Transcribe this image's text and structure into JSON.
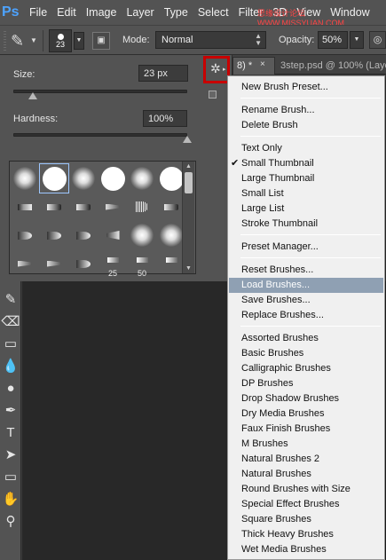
{
  "menubar": {
    "logo": "Ps",
    "items": [
      "File",
      "Edit",
      "Image",
      "Layer",
      "Type",
      "Select",
      "Filter",
      "3D",
      "View",
      "Window"
    ],
    "watermark": "思缘设计论坛 WWW.MISSYUAN.COM"
  },
  "options_bar": {
    "brush_size": "23",
    "mode_label": "Mode:",
    "mode_value": "Normal",
    "opacity_label": "Opacity:",
    "opacity_value": "50%"
  },
  "brush_panel": {
    "size_label": "Size:",
    "size_value": "23 px",
    "hardness_label": "Hardness:",
    "hardness_value": "100%",
    "size_slider_fraction": 0.11,
    "hardness_slider_fraction": 1.0,
    "presets": [
      {
        "tip": "soft",
        "num": ""
      },
      {
        "tip": "hard",
        "num": "",
        "selected": true
      },
      {
        "tip": "soft",
        "num": ""
      },
      {
        "tip": "hard",
        "num": ""
      },
      {
        "tip": "soft",
        "num": ""
      },
      {
        "tip": "hard",
        "num": ""
      },
      {
        "tip": "stroke",
        "num": ""
      },
      {
        "tip": "flat",
        "num": ""
      },
      {
        "tip": "flat",
        "num": ""
      },
      {
        "tip": "wedge",
        "num": ""
      },
      {
        "tip": "fan",
        "num": ""
      },
      {
        "tip": "flat",
        "num": ""
      },
      {
        "tip": "round",
        "num": ""
      },
      {
        "tip": "round",
        "num": ""
      },
      {
        "tip": "round",
        "num": ""
      },
      {
        "tip": "cone",
        "num": ""
      },
      {
        "tip": "soft",
        "num": ""
      },
      {
        "tip": "soft",
        "num": ""
      },
      {
        "tip": "wedge",
        "num": ""
      },
      {
        "tip": "wedge",
        "num": ""
      },
      {
        "tip": "round",
        "num": ""
      },
      {
        "tip": "small",
        "num": "25"
      },
      {
        "tip": "small",
        "num": "50"
      },
      {
        "tip": "small",
        "num": ""
      }
    ]
  },
  "tabs": [
    {
      "label": "8) *",
      "close": "×"
    },
    {
      "label": "3step.psd @ 100% (Layer"
    }
  ],
  "flyout_menu": {
    "groups": [
      {
        "items": [
          {
            "label": "New Brush Preset..."
          }
        ]
      },
      {
        "items": [
          {
            "label": "Rename Brush..."
          },
          {
            "label": "Delete Brush"
          }
        ]
      },
      {
        "items": [
          {
            "label": "Text Only"
          },
          {
            "label": "Small Thumbnail",
            "checked": true
          },
          {
            "label": "Large Thumbnail"
          },
          {
            "label": "Small List"
          },
          {
            "label": "Large List"
          },
          {
            "label": "Stroke Thumbnail"
          }
        ]
      },
      {
        "items": [
          {
            "label": "Preset Manager..."
          }
        ]
      },
      {
        "items": [
          {
            "label": "Reset Brushes..."
          },
          {
            "label": "Load Brushes...",
            "highlighted": true
          },
          {
            "label": "Save Brushes..."
          },
          {
            "label": "Replace Brushes..."
          }
        ]
      },
      {
        "items": [
          {
            "label": "Assorted Brushes"
          },
          {
            "label": "Basic Brushes"
          },
          {
            "label": "Calligraphic Brushes"
          },
          {
            "label": "DP Brushes"
          },
          {
            "label": "Drop Shadow Brushes"
          },
          {
            "label": "Dry Media Brushes"
          },
          {
            "label": "Faux Finish Brushes"
          },
          {
            "label": "M Brushes"
          },
          {
            "label": "Natural Brushes 2"
          },
          {
            "label": "Natural Brushes"
          },
          {
            "label": "Round Brushes with Size"
          },
          {
            "label": "Special Effect Brushes"
          },
          {
            "label": "Square Brushes"
          },
          {
            "label": "Thick Heavy Brushes"
          },
          {
            "label": "Wet Media Brushes"
          }
        ]
      }
    ]
  },
  "tools": [
    "brush-icon",
    "eraser-icon",
    "gradient-icon",
    "blur-icon",
    "dodge-icon",
    "pen-icon",
    "type-icon",
    "path-select-icon",
    "rectangle-icon",
    "hand-icon",
    "zoom-icon"
  ]
}
